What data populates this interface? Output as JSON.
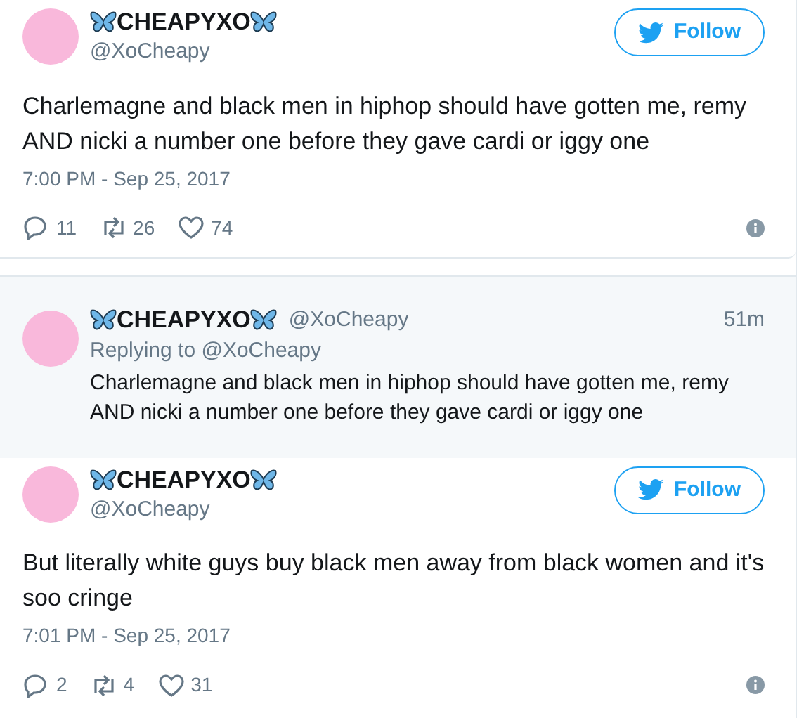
{
  "tweets": [
    {
      "kind": "embed",
      "display_name": "CHEAPYXO",
      "handle": "@XoCheapy",
      "follow_label": "Follow",
      "text": "Charlemagne and black men in hiphop should have gotten me, remy AND nicki a number one before they gave cardi or iggy one",
      "timestamp": "7:00 PM - Sep 25, 2017",
      "replies": "11",
      "retweets": "26",
      "likes": "74"
    },
    {
      "kind": "reply",
      "display_name": "CHEAPYXO",
      "handle": "@XoCheapy",
      "age": "51m",
      "replying_to": "Replying to @XoCheapy",
      "text": "Charlemagne and black men in hiphop should have gotten me, remy AND nicki a number one before they gave cardi or iggy one"
    },
    {
      "kind": "embed",
      "display_name": "CHEAPYXO",
      "handle": "@XoCheapy",
      "follow_label": "Follow",
      "text": "But literally white guys buy black men away from black women and it's soo cringe",
      "timestamp": "7:01 PM - Sep 25, 2017",
      "replies": "2",
      "retweets": "4",
      "likes": "31"
    }
  ]
}
